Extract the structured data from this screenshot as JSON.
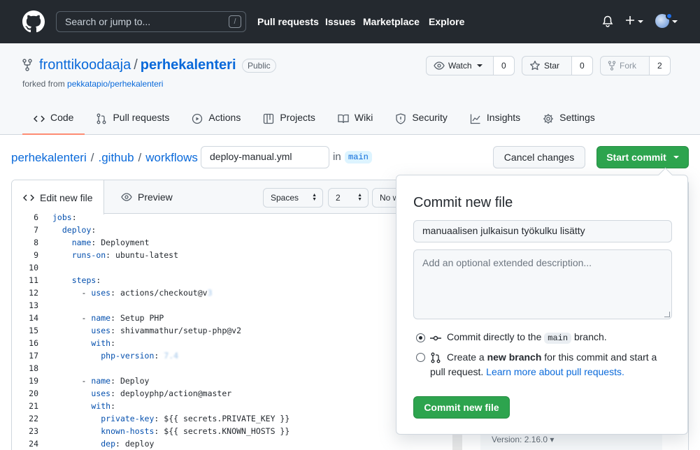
{
  "header": {
    "search_placeholder": "Search or jump to...",
    "search_key": "/",
    "nav": [
      "Pull requests",
      "Issues",
      "Marketplace",
      "Explore"
    ]
  },
  "repo": {
    "owner": "fronttikoodaaja",
    "separator": "/",
    "name": "perhekalenteri",
    "visibility": "Public",
    "forked_prefix": "forked from",
    "forked_from": "pekkatapio/perhekalenteri",
    "watch_label": "Watch",
    "watch_count": "0",
    "star_label": "Star",
    "star_count": "0",
    "fork_label": "Fork",
    "fork_count": "2"
  },
  "tabs": [
    {
      "label": "Code",
      "icon": "code-icon"
    },
    {
      "label": "Pull requests",
      "icon": "git-pull-request-icon"
    },
    {
      "label": "Actions",
      "icon": "play-icon"
    },
    {
      "label": "Projects",
      "icon": "table-icon"
    },
    {
      "label": "Wiki",
      "icon": "book-icon"
    },
    {
      "label": "Security",
      "icon": "shield-icon"
    },
    {
      "label": "Insights",
      "icon": "graph-icon"
    },
    {
      "label": "Settings",
      "icon": "gear-icon"
    }
  ],
  "breadcrumb": {
    "items": [
      "perhekalenteri",
      ".github",
      "workflows"
    ],
    "sep": "/",
    "filename": "deploy-manual.yml",
    "in_label": "in",
    "branch": "main"
  },
  "actions": {
    "cancel": "Cancel changes",
    "start_commit": "Start commit"
  },
  "editor": {
    "tab_edit": "Edit new file",
    "tab_preview": "Preview",
    "indent_mode": "Spaces",
    "indent_size": "2",
    "wrap_mode": "No w",
    "version": "Version: 2.16.0",
    "lines": [
      {
        "n": "6",
        "key": "jobs",
        "rest": ":",
        "indent": "",
        "dash": ""
      },
      {
        "n": "7",
        "key": "deploy",
        "rest": ":",
        "indent": "  ",
        "dash": ""
      },
      {
        "n": "8",
        "key": "name",
        "rest": ": Deployment",
        "indent": "    ",
        "dash": ""
      },
      {
        "n": "9",
        "key": "runs-on",
        "rest": ": ubuntu-latest",
        "indent": "    ",
        "dash": ""
      },
      {
        "n": "10",
        "key": "",
        "rest": "",
        "indent": "",
        "dash": ""
      },
      {
        "n": "11",
        "key": "steps",
        "rest": ":",
        "indent": "    ",
        "dash": ""
      },
      {
        "n": "12",
        "key": "uses",
        "rest": ": actions/checkout@v",
        "indent": "      ",
        "dash": "- ",
        "blur": "3"
      },
      {
        "n": "13",
        "key": "",
        "rest": "",
        "indent": "",
        "dash": ""
      },
      {
        "n": "14",
        "key": "name",
        "rest": ": Setup PHP",
        "indent": "      ",
        "dash": "- "
      },
      {
        "n": "15",
        "key": "uses",
        "rest": ": shivammathur/setup-php@v2",
        "indent": "        ",
        "dash": ""
      },
      {
        "n": "16",
        "key": "with",
        "rest": ":",
        "indent": "        ",
        "dash": ""
      },
      {
        "n": "17",
        "key": "php-version",
        "rest": ": ",
        "indent": "          ",
        "dash": "",
        "blur": "7.4"
      },
      {
        "n": "18",
        "key": "",
        "rest": "",
        "indent": "",
        "dash": ""
      },
      {
        "n": "19",
        "key": "name",
        "rest": ": Deploy",
        "indent": "      ",
        "dash": "- "
      },
      {
        "n": "20",
        "key": "uses",
        "rest": ": deployphp/action@master",
        "indent": "        ",
        "dash": ""
      },
      {
        "n": "21",
        "key": "with",
        "rest": ":",
        "indent": "        ",
        "dash": ""
      },
      {
        "n": "22",
        "key": "private-key",
        "rest": ": ${{ secrets.PRIVATE_KEY }}",
        "indent": "          ",
        "dash": ""
      },
      {
        "n": "23",
        "key": "known-hosts",
        "rest": ": ${{ secrets.KNOWN_HOSTS }}",
        "indent": "          ",
        "dash": ""
      },
      {
        "n": "24",
        "key": "dep",
        "rest": ": deploy",
        "indent": "          ",
        "dash": ""
      }
    ]
  },
  "commit": {
    "title": "Commit new file",
    "message": "manuaalisen julkaisun työkulku lisätty",
    "description_placeholder": "Add an optional extended description...",
    "opt1_prefix": "Commit directly to the",
    "opt1_branch": "main",
    "opt1_suffix": "branch.",
    "opt2_prefix": "Create a",
    "opt2_bold": "new branch",
    "opt2_suffix": "for this commit and start a",
    "opt2_line2": "pull request.",
    "opt2_link": "Learn more about pull requests.",
    "submit": "Commit new file"
  },
  "colors": {
    "header_bg": "#24292f",
    "primary_green": "#2da44e",
    "link_blue": "#0969da",
    "tab_underline": "#fd8c73"
  }
}
